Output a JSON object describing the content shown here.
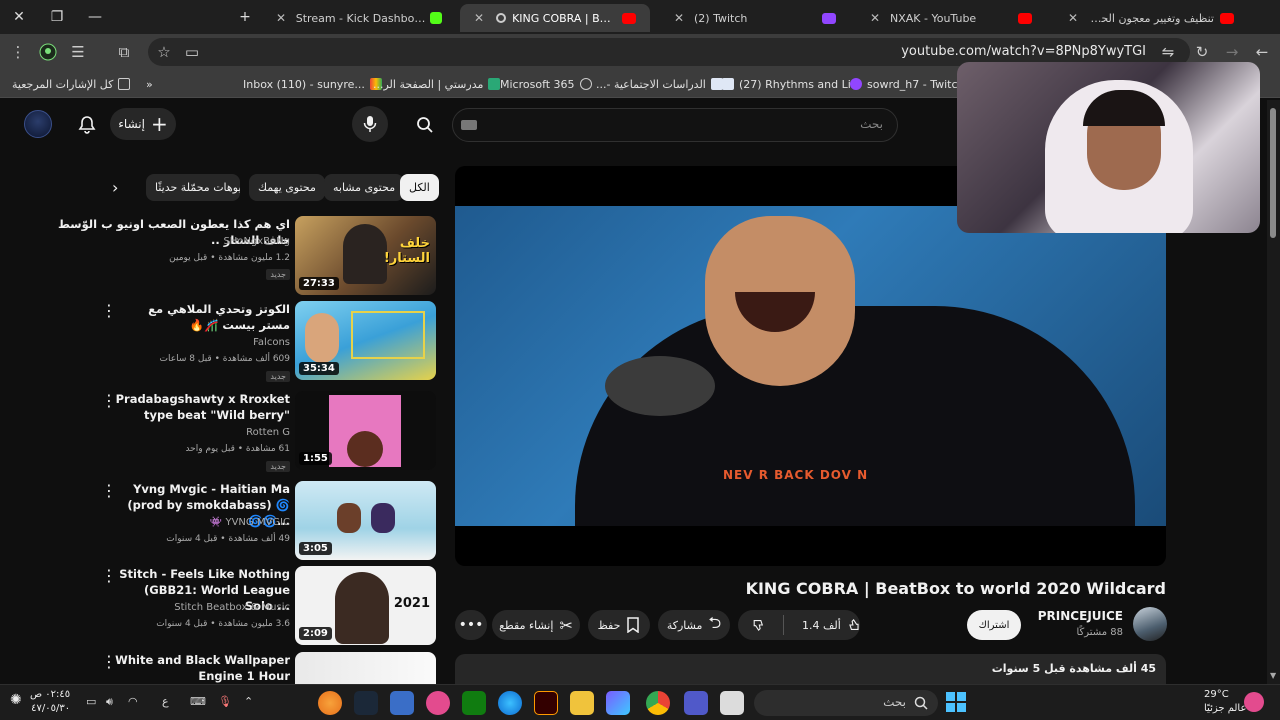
{
  "tabs": [
    {
      "title": "Stream - Kick Dashboard",
      "favicon": "kick-icon",
      "active": false
    },
    {
      "title": "KING COBRA | BeatBox to w",
      "favicon": "youtube-icon",
      "active": true
    },
    {
      "title": "(2) Twitch",
      "favicon": "twitch-icon",
      "active": false
    },
    {
      "title": "NXAK - YouTube",
      "favicon": "youtube-icon",
      "active": false
    },
    {
      "title": "تنظيف وتغيير معجون الحراري بلابتوب",
      "favicon": "youtube-icon",
      "active": false
    }
  ],
  "address": {
    "url": "youtube.com/watch?v=8PNp8YwyTGI"
  },
  "bookmarks": [
    {
      "label": "كل الإشارات المرجعية",
      "icon": "folder-icon"
    },
    {
      "label": "Inbox (110) - sunyre...",
      "icon": "gmail-icon"
    },
    {
      "label": "مدرستي | الصفحة الر...",
      "icon": "madrasati-icon"
    },
    {
      "label": "Microsoft 365",
      "icon": "globe-icon"
    },
    {
      "label": "الدراسات الاجتماعية -...",
      "icon": "doc-icon"
    },
    {
      "label": "(27) Rhythms and Li...",
      "icon": "doc-icon"
    },
    {
      "label": "sowrd_h7 - Twitch",
      "icon": "twitch-icon"
    }
  ],
  "yt": {
    "search_placeholder": "بحث",
    "create_label": "إنشاء"
  },
  "chips": [
    "الكل",
    "محتوى مشابه",
    "محتوى يهمك",
    "فيديوهات محمّلة حديثًا"
  ],
  "colors": {
    "accent_red": "#ff0000",
    "chip_bg": "#272727",
    "page_bg": "#0f0f0f"
  },
  "side_items": [
    {
      "title": "اي هم كذا يعطون الصعب اونيو ب الوّسط خلف الستار ..",
      "channel": "SHoNgxBoNg",
      "meta": "1.2 مليون مشاهدة • قبل يومين",
      "badge": "جديد",
      "duration": "27:33"
    },
    {
      "title": "الكوتز وتحدي الملاهي مع مستر بيست 🎢🔥",
      "channel": "Falcons",
      "meta": "609 ألف مشاهدة • قبل 8 ساعات",
      "badge": "جديد",
      "duration": "35:34"
    },
    {
      "title": "Pradabagshawty x Rroxket type beat \"Wild berry\"",
      "channel": "Rotten G",
      "meta": "61 مشاهدة • قبل يوم واحد",
      "badge": "جديد",
      "duration": "1:55"
    },
    {
      "title": "Yvng Mvgic - Haitian Ma (prod by smokdabass) 🌀🌀🌀...",
      "channel": "YVNG MVGIC 👾",
      "meta": "49 ألف مشاهدة • قبل 4 سنوات",
      "badge": "",
      "duration": "3:05"
    },
    {
      "title": "Stitch - Feels Like Nothing (GBB21: World League Solo ...",
      "channel": "Stitch Beatbox & Music",
      "meta": "3.6 مليون مشاهدة • قبل 4 سنوات",
      "badge": "",
      "duration": "2:09"
    },
    {
      "title": "White and Black Wallpaper Engine 1 Hour",
      "channel": "",
      "meta": "",
      "badge": "",
      "duration": ""
    }
  ],
  "video": {
    "title": "KING COBRA | BeatBox to world 2020 Wildcard",
    "shirt_text": "NEV R BACK DOV N",
    "channel": "PRINCEJUICE",
    "subscribers": "88 مشتركًا",
    "subscribe_label": "اشتراك",
    "likes": "1.4 ألف",
    "share_label": "مشاركة",
    "save_label": "حفظ",
    "clip_label": "إنشاء مقطع",
    "description_meta": "45 ألف مشاهدة  قبل 5 سنوات"
  },
  "taskbar": {
    "search_label": "بحث",
    "clock_time": "٠٢:٤٥ ص",
    "clock_date": "٤٧/٠٥/٣٠",
    "temperature": "29°C",
    "weather_label": "عالم جزئيًا",
    "lang": "ع"
  }
}
